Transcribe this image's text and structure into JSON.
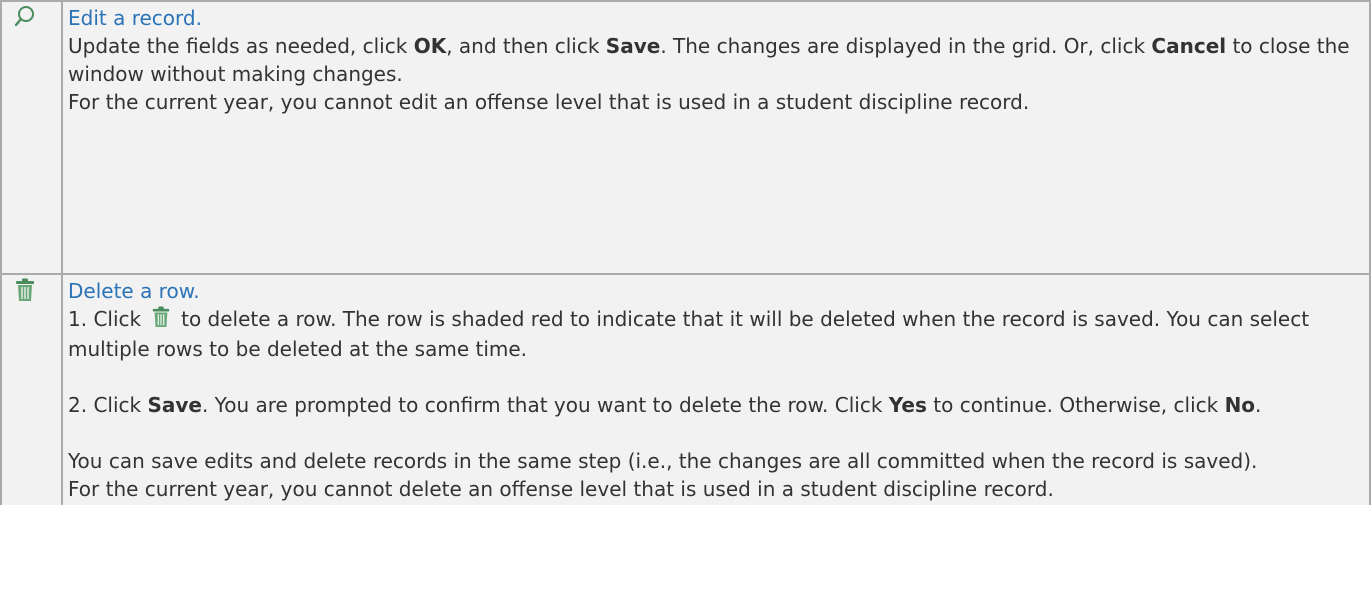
{
  "edit": {
    "icon": "magnifier-icon",
    "title": "Edit a record.",
    "p1_pre": "Update the fields as needed, click ",
    "p1_ok": "OK",
    "p1_mid": ", and then click ",
    "p1_save": "Save",
    "p1_mid2": ". The changes are displayed in the grid. Or, click ",
    "p1_cancel": "Cancel",
    "p1_post": " to close the window without making changes.",
    "p2": "For the current year, you cannot edit an offense level that is used in a student discipline record."
  },
  "delete": {
    "icon": "trash-icon",
    "title": "Delete a row.",
    "s1_pre": "1. Click",
    "s1_post": "to delete a row. The row is shaded red to indicate that it will be deleted when the record is saved. You can select multiple rows to be deleted at the same time.",
    "s2_pre": "2. Click ",
    "s2_save": "Save",
    "s2_mid": ". You are prompted to confirm that you want to delete the row. Click ",
    "s2_yes": "Yes",
    "s2_mid2": " to continue. Otherwise, click ",
    "s2_no": "No",
    "s2_post": ".",
    "p3": "You can save edits and delete records in the same step (i.e., the changes are all committed when the record is saved).",
    "p4": "For the current year, you cannot delete an offense level that is used in a student discipline record."
  },
  "colors": {
    "link": "#2b73b7",
    "border": "#aaaaaa",
    "cell_bg": "#f2f2f2",
    "icon_green": "#4a8c5c"
  }
}
